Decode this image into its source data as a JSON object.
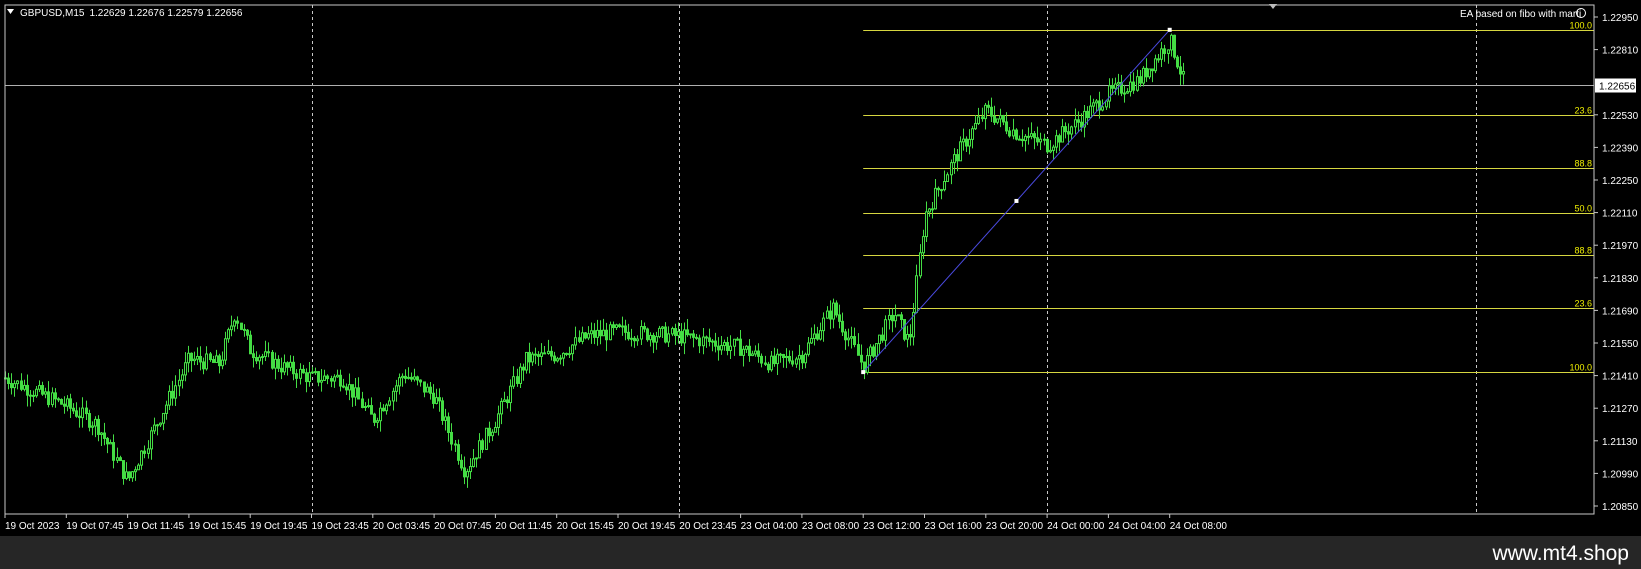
{
  "header": {
    "symbol_timeframe": "GBPUSD,M15",
    "ohlc": "1.22629 1.22676 1.22579 1.22656",
    "ea_label": "EA based on fibo with marti"
  },
  "watermark": "www.mt4.shop",
  "colors": {
    "background": "#000000",
    "candle_bull": "#44dd44",
    "candle_bear": "#44dd44",
    "grid": "#c8c8c8",
    "fibo": "#d6d640",
    "fibo_label": "#f0f000",
    "trendline": "#4a4ae0",
    "axis_text": "#ffffff"
  },
  "chart_data": {
    "type": "candlestick",
    "symbol": "GBPUSD",
    "timeframe": "M15",
    "current_price": "1.22656",
    "ylim": [
      1.2085,
      1.2295
    ],
    "y_ticks": [
      "1.22950",
      "1.22810",
      "1.22530",
      "1.22390",
      "1.22250",
      "1.22110",
      "1.21970",
      "1.21830",
      "1.21690",
      "1.21550",
      "1.21410",
      "1.21270",
      "1.21130",
      "1.20990",
      "1.20850"
    ],
    "x_ticks": [
      "19 Oct 2023",
      "19 Oct 07:45",
      "19 Oct 11:45",
      "19 Oct 15:45",
      "19 Oct 19:45",
      "19 Oct 23:45",
      "20 Oct 03:45",
      "20 Oct 07:45",
      "20 Oct 11:45",
      "20 Oct 15:45",
      "20 Oct 19:45",
      "20 Oct 23:45",
      "23 Oct 04:00",
      "23 Oct 08:00",
      "23 Oct 12:00",
      "23 Oct 16:00",
      "23 Oct 20:00",
      "24 Oct 00:00",
      "24 Oct 04:00",
      "24 Oct 08:00"
    ],
    "period_separators": [
      "19 Oct 23:45",
      "20 Oct 23:45",
      "24 Oct 00:00"
    ],
    "close_path": [
      {
        "x": "19 Oct 2023",
        "y": 1.214
      },
      {
        "x": "19 Oct 07:45",
        "y": 1.2128
      },
      {
        "x": "19 Oct 09:45",
        "y": 1.212
      },
      {
        "x": "19 Oct 11:45",
        "y": 1.2096
      },
      {
        "x": "19 Oct 13:45",
        "y": 1.2122
      },
      {
        "x": "19 Oct 15:45",
        "y": 1.2148
      },
      {
        "x": "19 Oct 17:45",
        "y": 1.2146
      },
      {
        "x": "19 Oct 18:45",
        "y": 1.2168
      },
      {
        "x": "19 Oct 19:45",
        "y": 1.2152
      },
      {
        "x": "19 Oct 21:45",
        "y": 1.2145
      },
      {
        "x": "19 Oct 23:45",
        "y": 1.214
      },
      {
        "x": "20 Oct 01:45",
        "y": 1.214
      },
      {
        "x": "20 Oct 03:45",
        "y": 1.2122
      },
      {
        "x": "20 Oct 05:45",
        "y": 1.2142
      },
      {
        "x": "20 Oct 07:45",
        "y": 1.2132
      },
      {
        "x": "20 Oct 09:45",
        "y": 1.21
      },
      {
        "x": "20 Oct 11:45",
        "y": 1.2122
      },
      {
        "x": "20 Oct 13:45",
        "y": 1.2148
      },
      {
        "x": "20 Oct 15:45",
        "y": 1.215
      },
      {
        "x": "20 Oct 17:45",
        "y": 1.2158
      },
      {
        "x": "20 Oct 19:45",
        "y": 1.216
      },
      {
        "x": "20 Oct 23:45",
        "y": 1.2158
      },
      {
        "x": "23 Oct 04:00",
        "y": 1.2153
      },
      {
        "x": "23 Oct 06:00",
        "y": 1.2146
      },
      {
        "x": "23 Oct 08:00",
        "y": 1.215
      },
      {
        "x": "23 Oct 10:00",
        "y": 1.217
      },
      {
        "x": "23 Oct 12:00",
        "y": 1.2145
      },
      {
        "x": "23 Oct 14:00",
        "y": 1.2168
      },
      {
        "x": "23 Oct 15:00",
        "y": 1.2155
      },
      {
        "x": "23 Oct 16:00",
        "y": 1.221
      },
      {
        "x": "23 Oct 18:00",
        "y": 1.2235
      },
      {
        "x": "23 Oct 20:00",
        "y": 1.2255
      },
      {
        "x": "23 Oct 22:00",
        "y": 1.2245
      },
      {
        "x": "24 Oct 00:00",
        "y": 1.224
      },
      {
        "x": "24 Oct 02:00",
        "y": 1.225
      },
      {
        "x": "24 Oct 04:00",
        "y": 1.2262
      },
      {
        "x": "24 Oct 06:00",
        "y": 1.2268
      },
      {
        "x": "24 Oct 08:00",
        "y": 1.2285
      },
      {
        "x": "24 Oct 09:00",
        "y": 1.22656
      }
    ],
    "fibo_levels": [
      {
        "label": "100.0",
        "price": 1.22895
      },
      {
        "label": "23.6",
        "price": 1.2253
      },
      {
        "label": "88.8",
        "price": 1.223
      },
      {
        "label": "50.0",
        "price": 1.2211
      },
      {
        "label": "88.8",
        "price": 1.2193
      },
      {
        "label": "23.6",
        "price": 1.217
      },
      {
        "label": "100.0",
        "price": 1.21425
      }
    ],
    "trendline": {
      "from": {
        "x": "23 Oct 12:00",
        "y": 1.21425
      },
      "to": {
        "x": "24 Oct 08:00",
        "y": 1.22895
      }
    }
  }
}
